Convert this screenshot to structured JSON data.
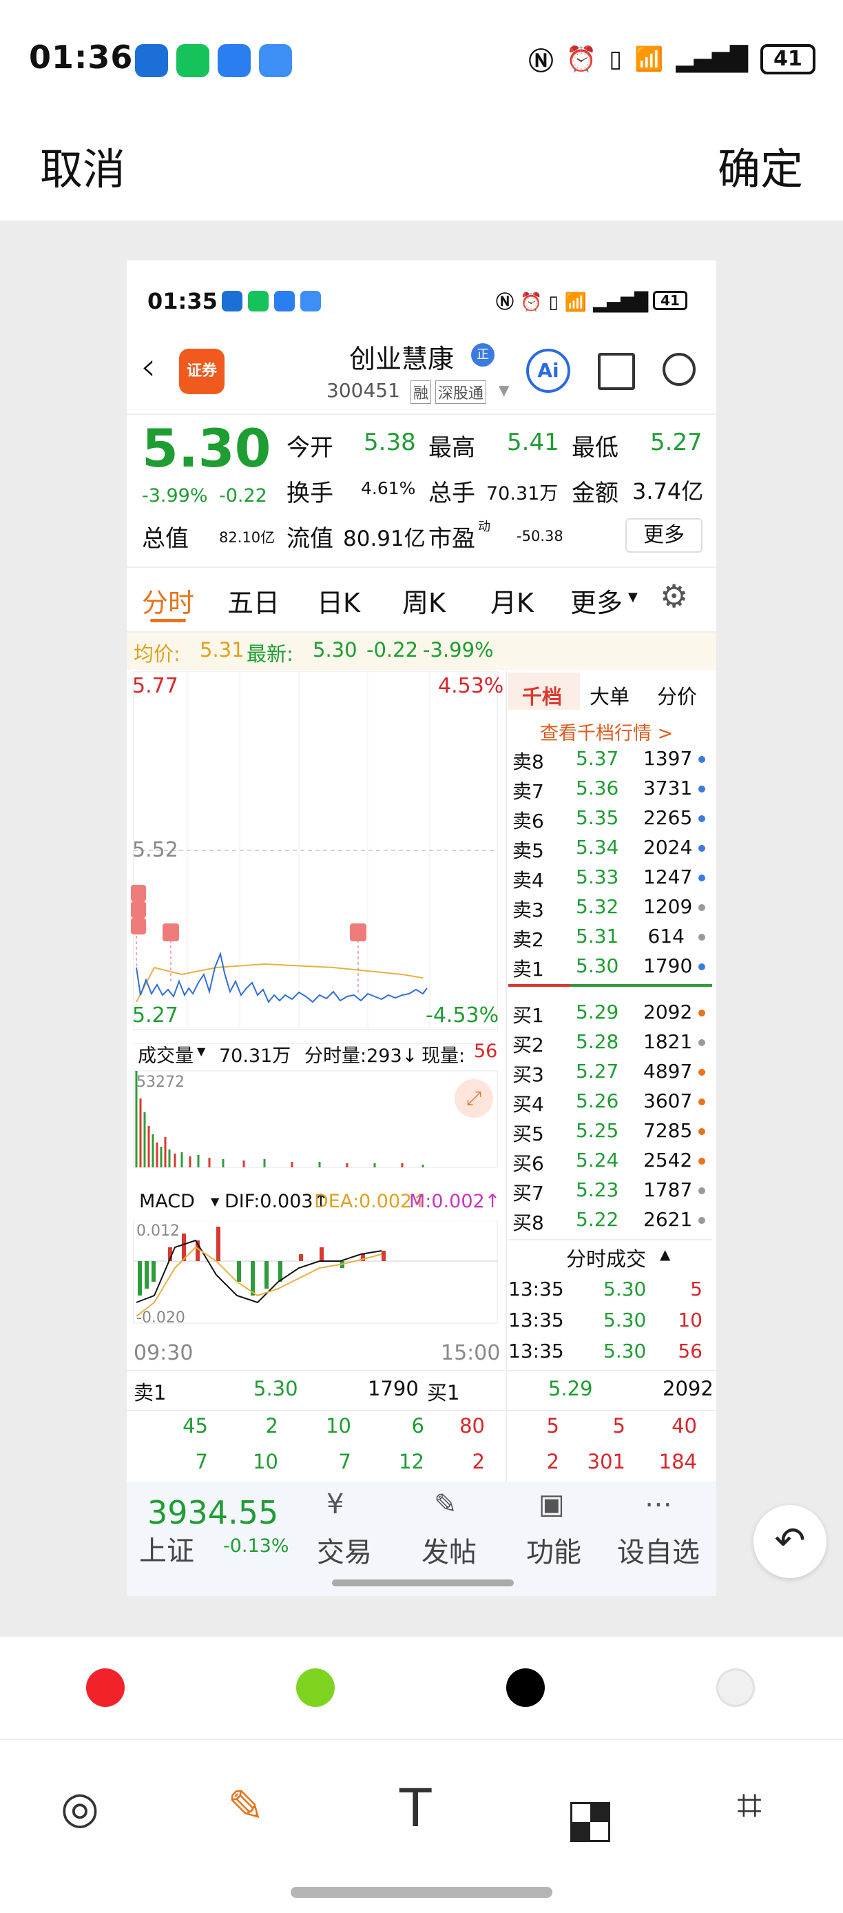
{
  "status_bar": {
    "time": "01:36",
    "battery": "41"
  },
  "editor": {
    "cancel": "取消",
    "confirm": "确定"
  },
  "shot": {
    "status_time": "01:35",
    "status_battery": "41",
    "stock_name": "创业慧康",
    "code": "300451",
    "tag1": "融",
    "tag2": "深股通",
    "broker_badge": "证券",
    "ai_label": "Ai",
    "price": "5.30",
    "change_pct": "-3.99%",
    "change": "-0.22",
    "open_label": "今开",
    "open": "5.38",
    "high_label": "最高",
    "high": "5.41",
    "low_label": "最低",
    "low": "5.27",
    "turnover_label": "换手",
    "turnover": "4.61%",
    "volume_label": "总手",
    "volume": "70.31万",
    "amount_label": "金额",
    "amount": "3.74亿",
    "mktcap_label": "总值",
    "mktcap": "82.10亿",
    "float_label": "流值",
    "float": "80.91亿",
    "pe_label": "市盈",
    "pe_sup": "动",
    "pe": "-50.38",
    "more": "更多",
    "tabs": [
      "分时",
      "五日",
      "日K",
      "周K",
      "月K",
      "更多"
    ],
    "avg_label": "均价:",
    "avg": "5.31",
    "latest_label": "最新:",
    "latest": "5.30",
    "latest_chg": "-0.22",
    "latest_pct": "-3.99%",
    "chart_hi": "5.77",
    "chart_hi_pct": "4.53%",
    "chart_mid": "5.52",
    "chart_lo": "5.27",
    "chart_lo_pct": "-4.53%",
    "vol_label": "成交量",
    "vol_total": "70.31万",
    "vol_tick": "分时量:293↓",
    "vol_now_label": "现量:",
    "vol_now": "56",
    "vol_max": "53272",
    "macd_label": "MACD",
    "dif": "DIF:0.003↑",
    "dea": "DEA:0.002↑",
    "m": "M:0.002↑",
    "macd_hi": "0.012",
    "macd_lo": "-0.020",
    "t_start": "09:30",
    "t_end": "15:00",
    "ob_tabs": [
      "千档",
      "大单",
      "分价"
    ],
    "ob_link": "查看千档行情 >",
    "asks": [
      {
        "label": "卖8",
        "price": "5.37",
        "vol": "1397"
      },
      {
        "label": "卖7",
        "price": "5.36",
        "vol": "3731"
      },
      {
        "label": "卖6",
        "price": "5.35",
        "vol": "2265"
      },
      {
        "label": "卖5",
        "price": "5.34",
        "vol": "2024"
      },
      {
        "label": "卖4",
        "price": "5.33",
        "vol": "1247"
      },
      {
        "label": "卖3",
        "price": "5.32",
        "vol": "1209"
      },
      {
        "label": "卖2",
        "price": "5.31",
        "vol": "614"
      },
      {
        "label": "卖1",
        "price": "5.30",
        "vol": "1790"
      }
    ],
    "bids": [
      {
        "label": "买1",
        "price": "5.29",
        "vol": "2092"
      },
      {
        "label": "买2",
        "price": "5.28",
        "vol": "1821"
      },
      {
        "label": "买3",
        "price": "5.27",
        "vol": "4897"
      },
      {
        "label": "买4",
        "price": "5.26",
        "vol": "3607"
      },
      {
        "label": "买5",
        "price": "5.25",
        "vol": "7285"
      },
      {
        "label": "买6",
        "price": "5.24",
        "vol": "2542"
      },
      {
        "label": "买7",
        "price": "5.23",
        "vol": "1787"
      },
      {
        "label": "买8",
        "price": "5.22",
        "vol": "2621"
      }
    ],
    "trades_title": "分时成交",
    "trades": [
      {
        "time": "13:35",
        "price": "5.30",
        "vol": "5"
      },
      {
        "time": "13:35",
        "price": "5.30",
        "vol": "10"
      },
      {
        "time": "13:35",
        "price": "5.30",
        "vol": "56"
      }
    ],
    "bottom_sell_label": "卖1",
    "bottom_sell_price": "5.30",
    "bottom_sell_vol": "1790",
    "bottom_buy_label": "买1",
    "bottom_buy_price": "5.29",
    "bottom_buy_vol": "2092",
    "queue_sell_1": [
      "45",
      "2",
      "10",
      "6"
    ],
    "queue_sell_2": [
      "7",
      "10",
      "7",
      "12"
    ],
    "queue_buy_1": [
      "80",
      "5",
      "5",
      "40"
    ],
    "queue_buy_2": [
      "2",
      "2",
      "301",
      "184"
    ],
    "index_value": "3934.55",
    "index_name": "上证",
    "index_pct": "-0.13%",
    "nav": [
      "交易",
      "发帖",
      "功能",
      "设自选"
    ]
  },
  "palette": {
    "colors": [
      "#f2222b",
      "#7ed321",
      "#000000",
      "#f0f0f0"
    ]
  }
}
